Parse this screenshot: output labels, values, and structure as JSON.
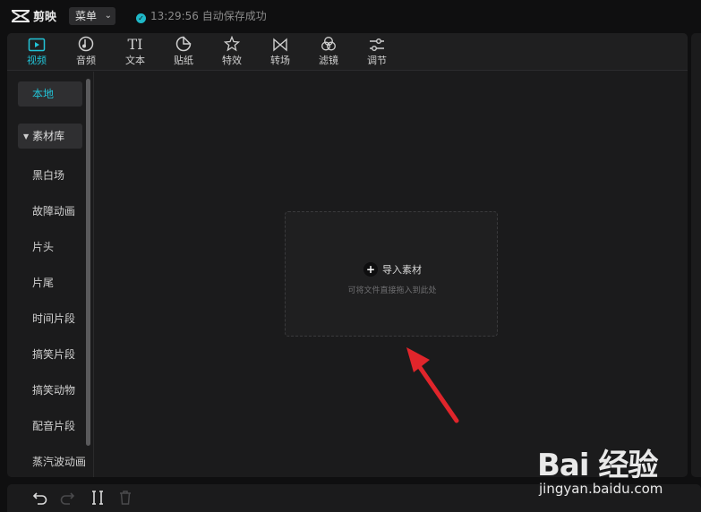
{
  "titlebar": {
    "app_name": "剪映",
    "menu_label": "菜单",
    "status_time": "13:29:56",
    "status_text": "自动保存成功"
  },
  "toolbar": {
    "tabs": [
      {
        "label": "视频",
        "icon": "video-icon",
        "active": true
      },
      {
        "label": "音频",
        "icon": "audio-icon",
        "active": false
      },
      {
        "label": "文本",
        "icon": "text-icon",
        "active": false
      },
      {
        "label": "贴纸",
        "icon": "sticker-icon",
        "active": false
      },
      {
        "label": "特效",
        "icon": "effects-icon",
        "active": false
      },
      {
        "label": "转场",
        "icon": "transition-icon",
        "active": false
      },
      {
        "label": "滤镜",
        "icon": "filter-icon",
        "active": false
      },
      {
        "label": "调节",
        "icon": "adjust-icon",
        "active": false
      }
    ]
  },
  "sidebar": {
    "local": "本地",
    "library": "素材库",
    "items": [
      "黑白场",
      "故障动画",
      "片头",
      "片尾",
      "时间片段",
      "搞笑片段",
      "搞笑动物",
      "配音片段",
      "蒸汽波动画"
    ]
  },
  "import": {
    "label": "导入素材",
    "hint": "可将文件直接拖入到此处"
  },
  "watermark": {
    "brand": "Bai 经验",
    "url": "jingyan.baidu.com"
  },
  "colors": {
    "accent": "#22c3d6",
    "arrow": "#e0252b",
    "panel": "#1b1b1c",
    "background": "#0f0f10"
  }
}
